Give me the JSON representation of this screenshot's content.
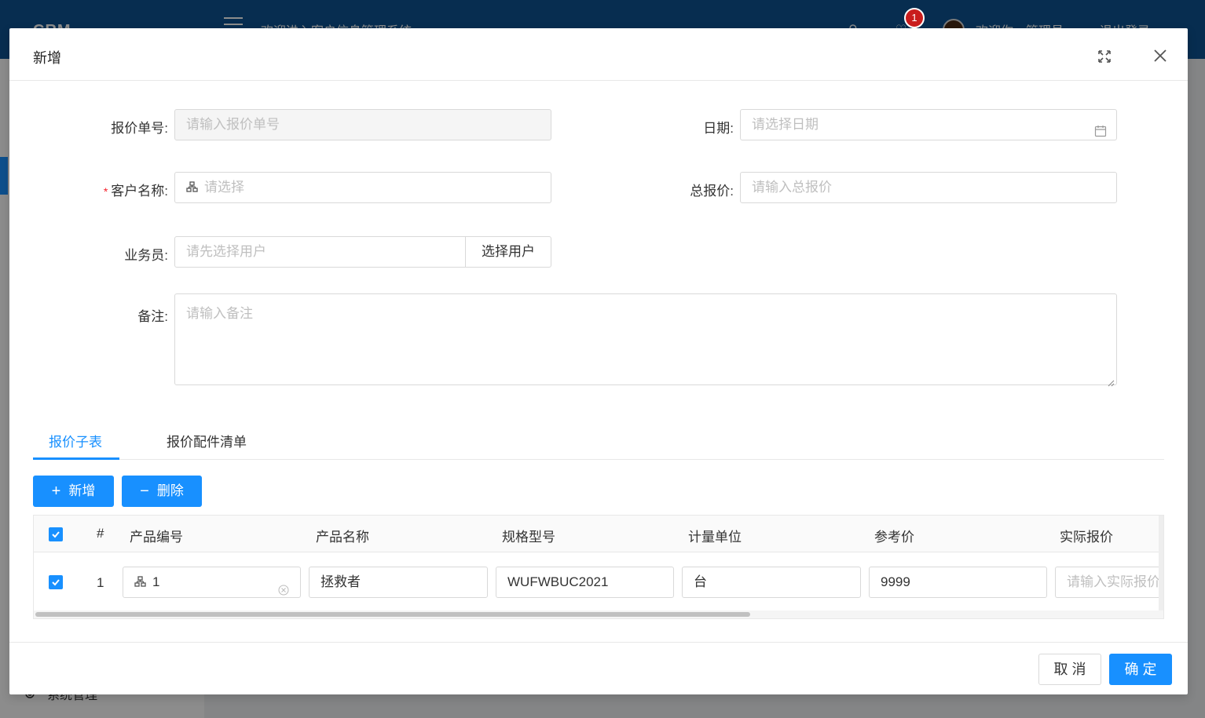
{
  "app": {
    "logo": "CRM",
    "welcome": "欢迎进入客户信息管理系统",
    "badge_count": "1",
    "user_greeting": "欢迎你，管理员",
    "logout": "退出登录",
    "sidebar_bottom": "系统管理"
  },
  "modal": {
    "title": "新增",
    "form": {
      "quote_no": {
        "label": "报价单号:",
        "placeholder": "请输入报价单号"
      },
      "date": {
        "label": "日期:",
        "placeholder": "请选择日期"
      },
      "customer": {
        "label": "客户名称:",
        "placeholder": "请选择",
        "required": "*"
      },
      "total_price": {
        "label": "总报价:",
        "placeholder": "请输入总报价"
      },
      "salesman": {
        "label": "业务员:",
        "placeholder": "请先选择用户",
        "button": "选择用户"
      },
      "remark": {
        "label": "备注:",
        "placeholder": "请输入备注"
      }
    },
    "tabs": [
      {
        "label": "报价子表",
        "active": true
      },
      {
        "label": "报价配件清单",
        "active": false
      }
    ],
    "toolbar": {
      "add_label": "新增",
      "delete_label": "删除"
    },
    "table": {
      "columns": [
        "#",
        "产品编号",
        "产品名称",
        "规格型号",
        "计量单位",
        "参考价",
        "实际报价"
      ],
      "rows": [
        {
          "index": "1",
          "product_no": "1",
          "product_name": "拯救者",
          "spec": "WUFWBUC2021",
          "unit": "台",
          "ref_price": "9999",
          "actual_price_placeholder": "请输入实际报价"
        }
      ]
    },
    "footer": {
      "cancel_label": "取 消",
      "ok_label": "确 定"
    }
  },
  "colors": {
    "primary": "#1890ff",
    "header": "#0e5392",
    "required": "#f5222d"
  }
}
